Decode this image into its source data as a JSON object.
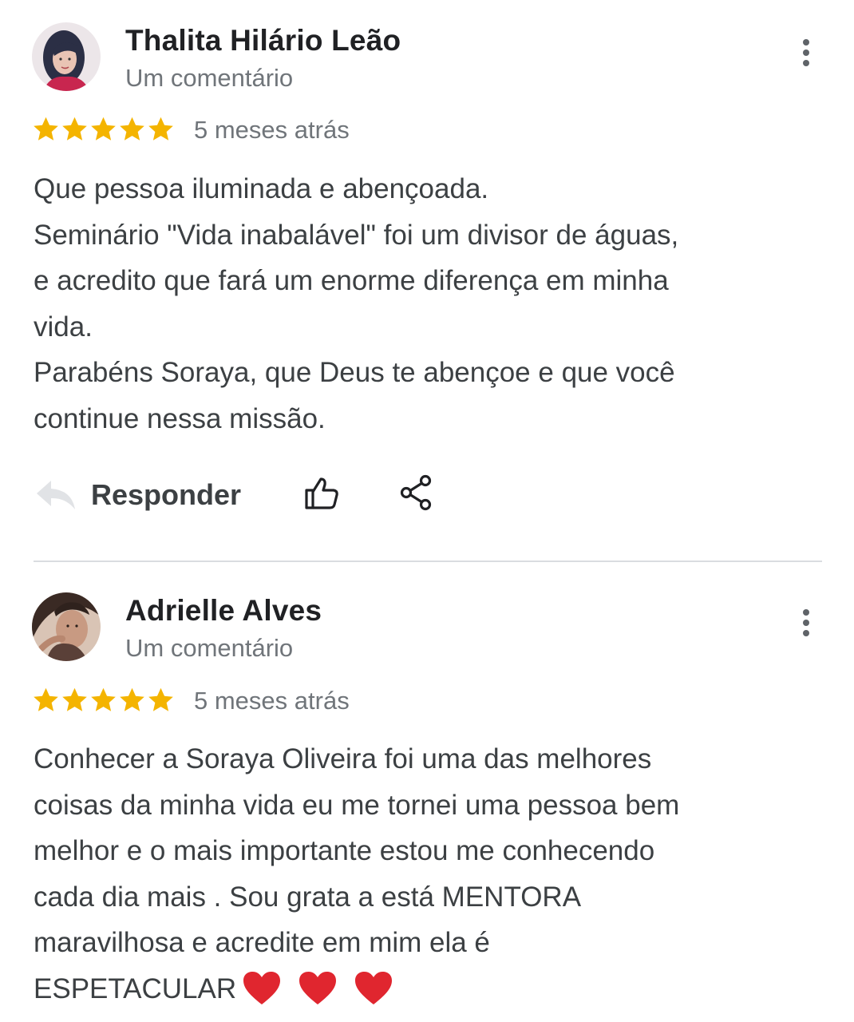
{
  "reviews": [
    {
      "author": "Thalita Hilário Leão",
      "subtitle": "Um comentário",
      "rating": 5,
      "time": "5 meses atrás",
      "lines": [
        "Que pessoa iluminada e abençoada.",
        "Seminário \"Vida inabalável\" foi um divisor de águas,",
        "e acredito que fará um enorme diferença em minha",
        "vida.",
        "Parabéns Soraya, que Deus te abençoe e que você",
        "continue nessa missão."
      ],
      "reply_label": "Responder"
    },
    {
      "author": "Adrielle Alves",
      "subtitle": "Um comentário",
      "rating": 5,
      "time": "5 meses atrás",
      "lines": [
        "Conhecer a Soraya Oliveira foi uma das melhores",
        "coisas da minha vida eu me tornei uma pessoa bem",
        "melhor e o mais importante estou me conhecendo",
        "cada dia mais . Sou grata a está MENTORA",
        "maravilhosa e acredite em mim ela é",
        "ESPETACULAR"
      ],
      "trailing_emoji": [
        "heart-icon",
        "heart-icon",
        "heart-icon"
      ]
    }
  ],
  "colors": {
    "star": "#f4b400",
    "heart": "#e0262f",
    "icon_gray": "#5f6368",
    "divider": "#dadce0"
  }
}
